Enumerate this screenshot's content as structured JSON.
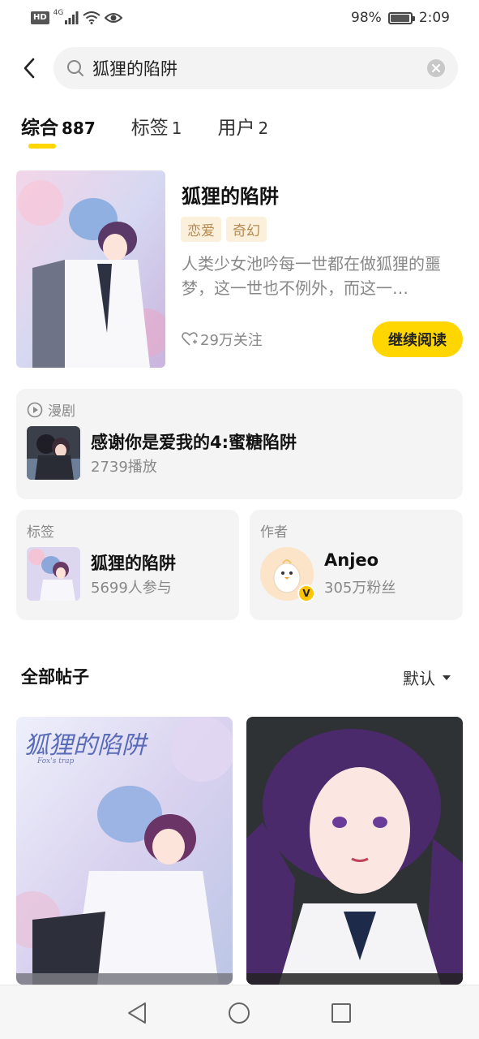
{
  "status_bar": {
    "network_badge": "HD",
    "network_type": "4G",
    "battery_percent": "98%",
    "battery_level": 0.98,
    "time": "2:09"
  },
  "search": {
    "query": "狐狸的陷阱"
  },
  "tabs": [
    {
      "label": "综合",
      "count": "887",
      "active": true
    },
    {
      "label": "标签",
      "count": "1",
      "active": false
    },
    {
      "label": "用户",
      "count": "2",
      "active": false
    }
  ],
  "top_result": {
    "title": "狐狸的陷阱",
    "tags": [
      "恋爱",
      "奇幻"
    ],
    "description": "人类少女池吟每一世都在做狐狸的噩梦，这一世也不例外，而这一…",
    "follow_count": "29万关注",
    "continue_button": "继续阅读"
  },
  "drama_card": {
    "label": "漫剧",
    "title": "感谢你是爱我的4:蜜糖陷阱",
    "plays": "2739播放"
  },
  "tag_card": {
    "label": "标签",
    "title": "狐狸的陷阱",
    "participants": "5699人参与"
  },
  "author_card": {
    "label": "作者",
    "name": "Anjeo",
    "fans": "305万粉丝",
    "verified_mark": "V"
  },
  "posts": {
    "section_title": "全部帖子",
    "sort_value": "默认",
    "post1_cover_title": "狐狸的陷阱",
    "post1_cover_subtitle": "Fox's trap"
  },
  "colors": {
    "accent_yellow": "#ffd600",
    "tag_bg": "#fbf0dc",
    "tag_text": "#b58a52",
    "card_bg": "#f4f4f4"
  }
}
